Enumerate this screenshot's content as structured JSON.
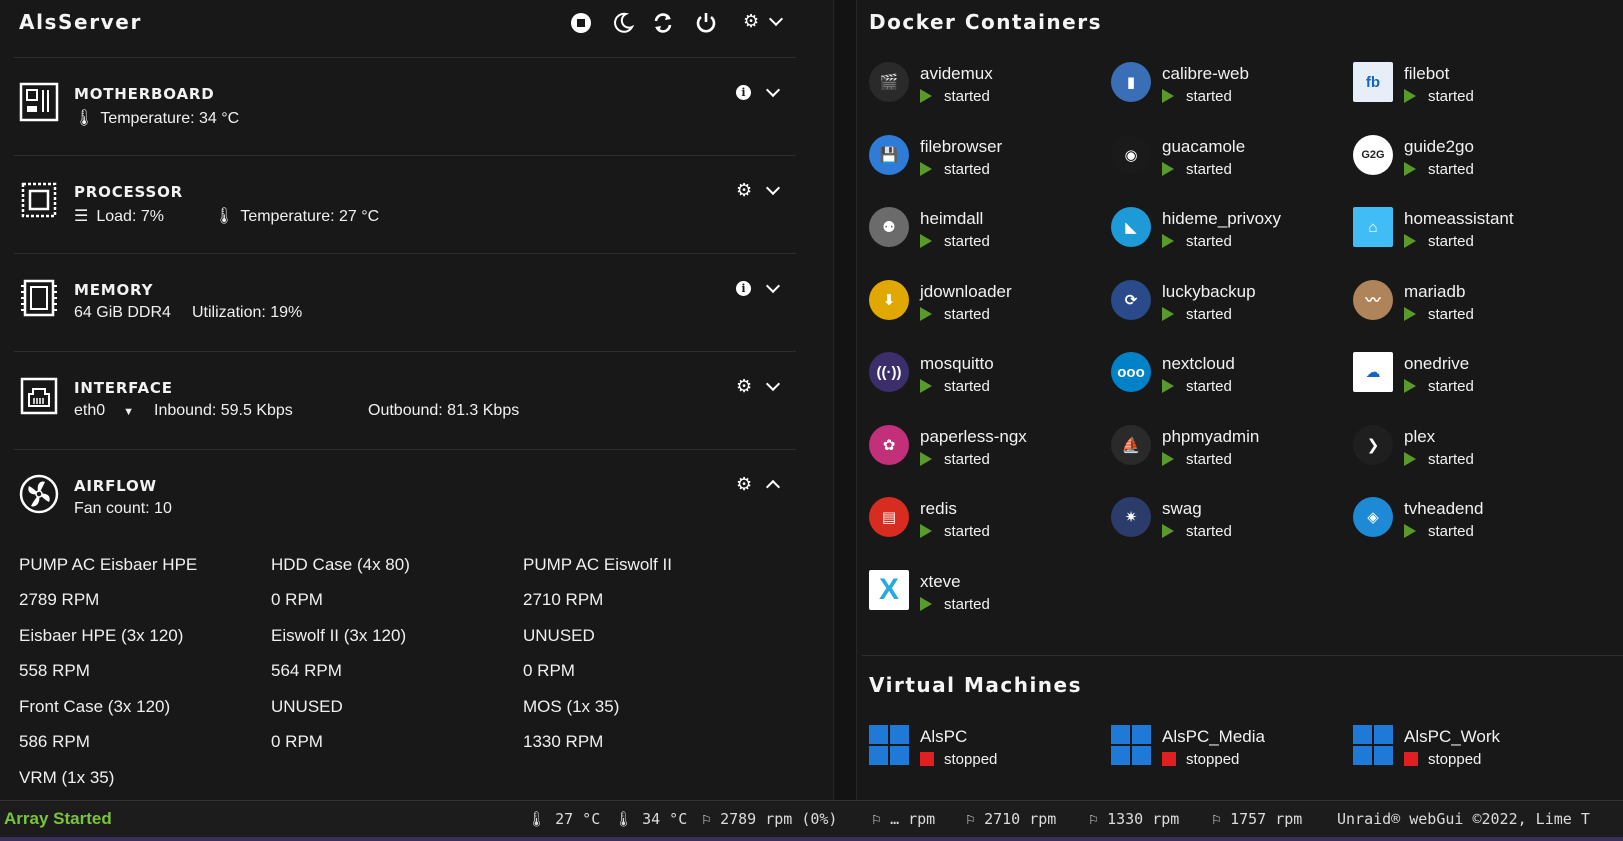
{
  "server": {
    "title": "AlsServer",
    "icons": [
      "stop-icon",
      "moon-icon",
      "refresh-icon",
      "power-icon",
      "gear-icon",
      "chevron-down-icon"
    ]
  },
  "motherboard": {
    "title": "MOTHERBOARD",
    "temperature": "Temperature: 34 °C"
  },
  "processor": {
    "title": "PROCESSOR",
    "load": "Load: 7%",
    "temperature": "Temperature: 27 °C"
  },
  "memory": {
    "title": "MEMORY",
    "size": "64 GiB DDR4",
    "utilization": "Utilization: 19%"
  },
  "interface": {
    "title": "INTERFACE",
    "selected": "eth0",
    "inbound": "Inbound: 59.5 Kbps",
    "outbound": "Outbound: 81.3 Kbps"
  },
  "airflow": {
    "title": "AIRFLOW",
    "fan_count": "Fan count: 10",
    "fans": [
      [
        "PUMP AC Eisbaer HPE",
        "HDD Case (4x 80)",
        "PUMP AC Eiswolf II"
      ],
      [
        "2789 RPM",
        "0 RPM",
        "2710 RPM"
      ],
      [
        "Eisbaer HPE (3x 120)",
        "Eiswolf II (3x 120)",
        "UNUSED"
      ],
      [
        "558 RPM",
        "564 RPM",
        "0 RPM"
      ],
      [
        "Front Case (3x 120)",
        "UNUSED",
        "MOS (1x 35)"
      ],
      [
        "586 RPM",
        "0 RPM",
        "1330 RPM"
      ],
      [
        "VRM (1x 35)",
        "",
        ""
      ]
    ]
  },
  "docker": {
    "title": "Docker Containers",
    "containers": [
      {
        "name": "avidemux",
        "status": "started",
        "icon": "clapperboard-icon",
        "color": "#2a2a2a"
      },
      {
        "name": "calibre-web",
        "status": "started",
        "icon": "book-icon",
        "color": "#3a6fb8"
      },
      {
        "name": "filebot",
        "status": "started",
        "icon": "fb-icon",
        "color": "#e8eef7"
      },
      {
        "name": "filebrowser",
        "status": "started",
        "icon": "floppy-icon",
        "color": "#2f7bd8"
      },
      {
        "name": "guacamole",
        "status": "started",
        "icon": "guacamole-icon",
        "color": "#1a1a1a"
      },
      {
        "name": "guide2go",
        "status": "started",
        "icon": "g2g-icon",
        "color": "#ffffff"
      },
      {
        "name": "heimdall",
        "status": "started",
        "icon": "heimdall-icon",
        "color": "#6b6b6b"
      },
      {
        "name": "hideme_privoxy",
        "status": "started",
        "icon": "hideme-icon",
        "color": "#1e9ad6"
      },
      {
        "name": "homeassistant",
        "status": "started",
        "icon": "home-icon",
        "color": "#41bdf5"
      },
      {
        "name": "jdownloader",
        "status": "started",
        "icon": "jdownloader-icon",
        "color": "#e0a800"
      },
      {
        "name": "luckybackup",
        "status": "started",
        "icon": "sync-icon",
        "color": "#2a4a8a"
      },
      {
        "name": "mariadb",
        "status": "started",
        "icon": "seal-icon",
        "color": "#b0845a"
      },
      {
        "name": "mosquitto",
        "status": "started",
        "icon": "antenna-icon",
        "color": "#3c2e6a"
      },
      {
        "name": "nextcloud",
        "status": "started",
        "icon": "nextcloud-icon",
        "color": "#0082c9"
      },
      {
        "name": "onedrive",
        "status": "started",
        "icon": "cloud-icon",
        "color": "#ffffff"
      },
      {
        "name": "paperless-ngx",
        "status": "started",
        "icon": "paperless-icon",
        "color": "#c2307a"
      },
      {
        "name": "phpmyadmin",
        "status": "started",
        "icon": "sailboat-icon",
        "color": "#2a2a2a"
      },
      {
        "name": "plex",
        "status": "started",
        "icon": "plex-icon",
        "color": "#1f1f1f"
      },
      {
        "name": "redis",
        "status": "started",
        "icon": "redis-icon",
        "color": "#d82c20"
      },
      {
        "name": "swag",
        "status": "started",
        "icon": "letsencrypt-icon",
        "color": "#2c3c6a"
      },
      {
        "name": "tvheadend",
        "status": "started",
        "icon": "tvheadend-icon",
        "color": "#1e8ad6"
      },
      {
        "name": "xteve",
        "status": "started",
        "icon": "x-icon",
        "color": "#ffffff"
      }
    ]
  },
  "vms": {
    "title": "Virtual Machines",
    "machines": [
      {
        "name": "AlsPC",
        "status": "stopped"
      },
      {
        "name": "AlsPC_Media",
        "status": "stopped"
      },
      {
        "name": "AlsPC_Work",
        "status": "stopped"
      }
    ]
  },
  "statusbar": {
    "array": "Array Started",
    "cpu_temp": "27 °C",
    "mb_temp": "34 °C",
    "fan1": "2789 rpm (0%)",
    "fan2": "… rpm",
    "fan3": "2710 rpm",
    "fan4": "1330 rpm",
    "fan5": "1757 rpm",
    "copyright": "Unraid® webGui ©2022, Lime T"
  }
}
